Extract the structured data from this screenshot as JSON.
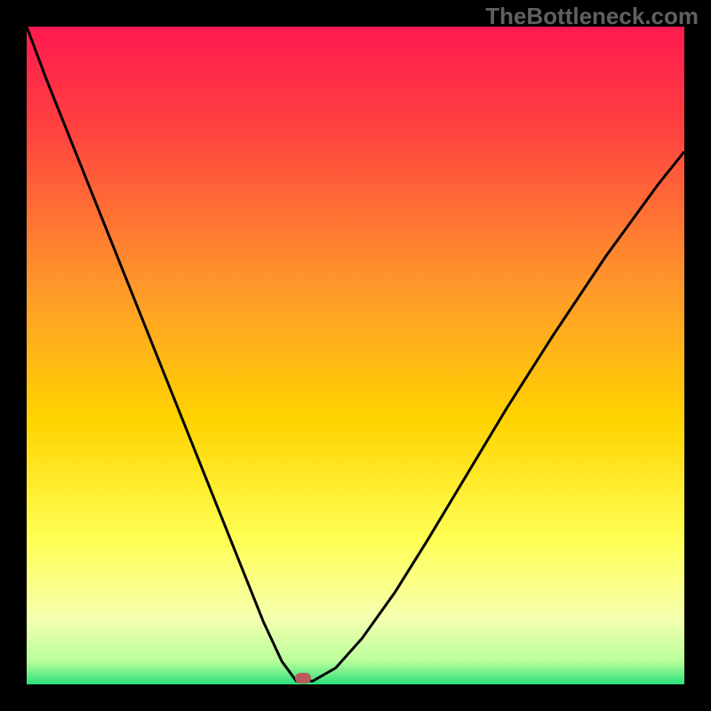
{
  "watermark": "TheBottleneck.com",
  "colors": {
    "top": "#ff1a50",
    "mid_upper": "#ff8a2a",
    "mid": "#ffd400",
    "mid_lower": "#ffff66",
    "near_bottom": "#f7ffb0",
    "bottom": "#2be07a",
    "curve": "#000000",
    "marker": "#b85c5c",
    "background": "#000000"
  },
  "chart_data": {
    "type": "line",
    "title": "",
    "xlabel": "",
    "ylabel": "",
    "xlim": [
      0,
      100
    ],
    "ylim": [
      0,
      100
    ],
    "optimal_x": 41,
    "marker": {
      "x": 42,
      "y": 1
    },
    "series": [
      {
        "name": "bottleneck-curve",
        "x": [
          0,
          3,
          6,
          9,
          12,
          15,
          18,
          21,
          24,
          27,
          30,
          33,
          36,
          38.8,
          41,
          43.5,
          47,
          51,
          56,
          61,
          67,
          73,
          80,
          88,
          96,
          100
        ],
        "y": [
          100,
          92,
          84.5,
          77,
          69.5,
          62,
          54.5,
          47,
          39.5,
          32,
          24.5,
          17,
          9.5,
          3.5,
          0.5,
          0.5,
          2.5,
          7,
          14,
          22,
          32,
          42,
          53,
          65,
          76,
          81
        ]
      }
    ],
    "gradient_stops": [
      {
        "offset": 0.0,
        "color": "#ff1a50"
      },
      {
        "offset": 0.15,
        "color": "#ff4040"
      },
      {
        "offset": 0.4,
        "color": "#ff9a2a"
      },
      {
        "offset": 0.6,
        "color": "#ffd400"
      },
      {
        "offset": 0.78,
        "color": "#ffff55"
      },
      {
        "offset": 0.9,
        "color": "#f5ffb0"
      },
      {
        "offset": 0.965,
        "color": "#b8ff9a"
      },
      {
        "offset": 1.0,
        "color": "#2be07a"
      }
    ]
  }
}
